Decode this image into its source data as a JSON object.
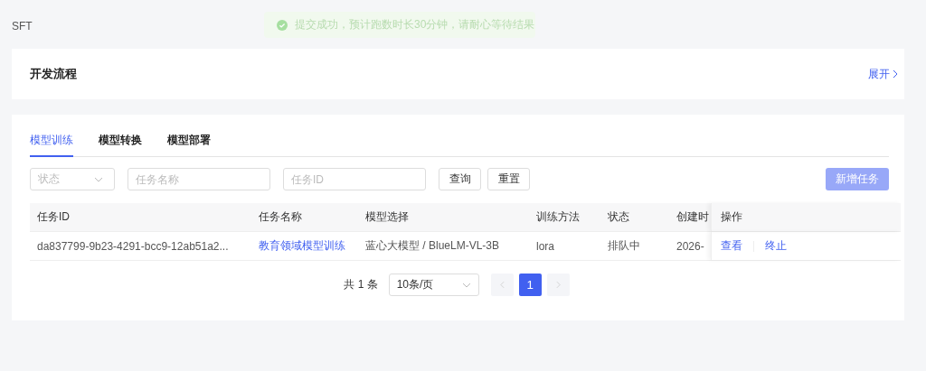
{
  "breadcrumb": "SFT",
  "toast": {
    "message": "提交成功，预计跑数时长30分钟，请耐心等待结果"
  },
  "flow_card": {
    "title": "开发流程",
    "expand_link": "展开"
  },
  "tabs": [
    {
      "label": "模型训练",
      "selected": true
    },
    {
      "label": "模型转换",
      "selected": false
    },
    {
      "label": "模型部署",
      "selected": false
    }
  ],
  "filters": {
    "status": {
      "placeholder": "状态"
    },
    "task_name": {
      "placeholder": "任务名称"
    },
    "task_id": {
      "placeholder": "任务ID"
    },
    "query_button": "查询",
    "reset_button": "重置"
  },
  "add_button": {
    "label": "新增任务",
    "disabled": true
  },
  "table": {
    "columns": [
      "任务ID",
      "任务名称",
      "模型选择",
      "训练方法",
      "状态",
      "创建时"
    ],
    "actions_column": "操作",
    "rows": [
      {
        "cells": [
          "da837799-9b23-4291-bcc9-12ab51a2...",
          "教育领域模型训练",
          "蓝心大模型 / BlueLM-VL-3B",
          "lora",
          "排队中",
          "2026-"
        ],
        "actions": [
          "查看",
          "终止"
        ]
      }
    ]
  },
  "pagination": {
    "total": "共 1 条",
    "page_size": "10条/页",
    "pages": [
      {
        "label": "1",
        "selected": true
      }
    ]
  }
}
